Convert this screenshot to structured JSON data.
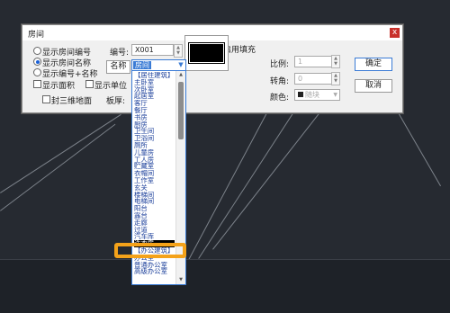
{
  "dialog": {
    "title": "房间",
    "close_glyph": "x",
    "display_options": [
      {
        "label": "显示房间编号",
        "selected": false
      },
      {
        "label": "显示房间名称",
        "selected": true
      },
      {
        "label": "显示编号+名称",
        "selected": false
      }
    ],
    "show_area": {
      "label": "显示面积",
      "checked": false
    },
    "show_unit": {
      "label": "显示单位",
      "checked": false
    },
    "seal_3d_floor": {
      "label": "封三维地面",
      "checked": false
    },
    "code_label": "编号:",
    "code_value": "X001",
    "name_label": "名称",
    "name_value": "房间",
    "slab_label": "板厚:",
    "fill": {
      "label": "启用填充",
      "checked": false
    },
    "scale_label": "比例:",
    "scale_value": "1",
    "angle_label": "转角:",
    "angle_value": "0",
    "color_label": "颜色:",
    "color_value": "随块",
    "ok_label": "确定",
    "cancel_label": "取消"
  },
  "dropdown": {
    "items": [
      "【居住建筑】",
      "主卧室",
      "次卧室",
      "起居室",
      "客厅",
      "餐厅",
      "书房",
      "厨房",
      "卫生间",
      "卫浴间",
      "厕所",
      "儿童房",
      "工人房",
      "贮藏室",
      "衣帽间",
      "工作室",
      "玄关",
      "楼梯间",
      "电梯间",
      "阳台",
      "露台",
      "走廊",
      "过道",
      "汽车库",
      "洗衣房",
      "【办公建筑】",
      "办公室",
      "普通办公室",
      "高级办公室"
    ],
    "selected_index": 24,
    "scroll_up": "▲",
    "scroll_down": "▼"
  },
  "colors": {
    "accent": "#3a7bd5",
    "highlight": "#f4a21a",
    "close": "#c8302a",
    "background": "#262a31"
  }
}
